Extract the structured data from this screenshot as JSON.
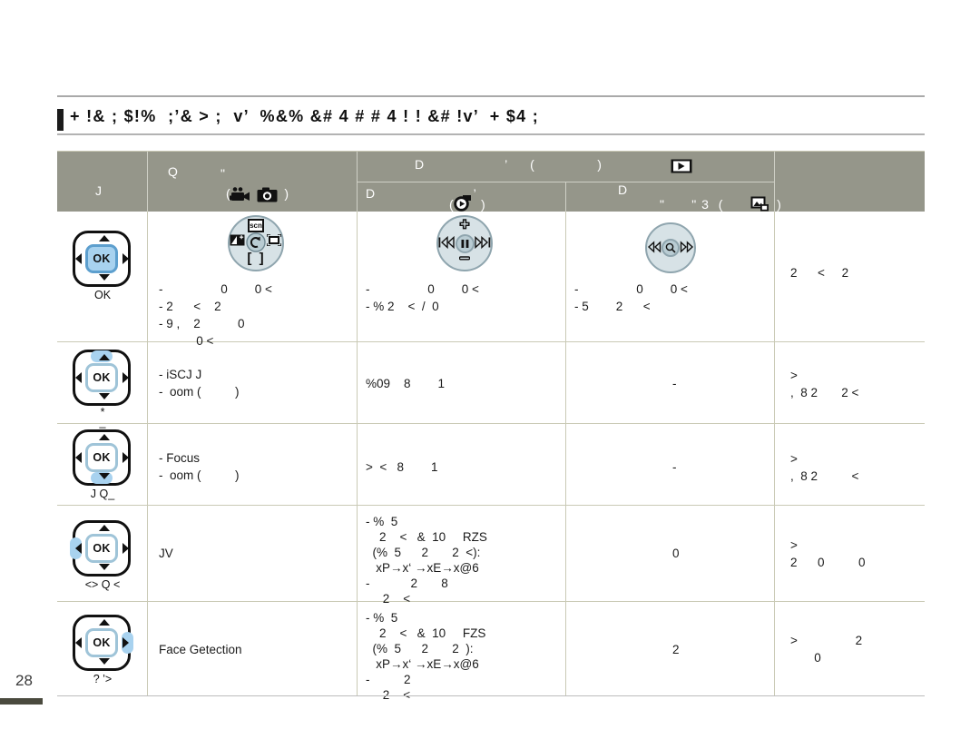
{
  "page": {
    "number": "28",
    "section_heading": "+ !& ; $!%  ;’& > ;  v’  %&% &# 4 # # 4 ! ! &# !v’  + $4 ;"
  },
  "table": {
    "headers": {
      "col_button": "J",
      "col_recording": "Q",
      "col_recording_icons": "(            )",
      "col_playback_top": "D                  ’     (              )",
      "col_playback_video": "D                      ’",
      "col_playback_video_icon": "(      )",
      "col_playback_photo": "D",
      "col_playback_photo_icon": "\"      \" 3  (            )",
      "col_last": ""
    },
    "rows": [
      {
        "name": "row-ok",
        "dpad": {
          "label": "OK",
          "highlight": "ok"
        },
        "rec_pad": "scn-pad",
        "rec_text": "-                 0        0 <\n- 2      <    2\n- 9 ,    2           0\n           0 <",
        "play_video_pad": "playpause-pad",
        "play_video_text": "-                 0        0 <\n- % 2    <  /  0",
        "play_photo_pad": "zoom-pad",
        "play_photo_text": "-                 0        0 <\n- 5        2      <",
        "last_text": "2      <     2"
      },
      {
        "name": "row-up",
        "dpad": {
          "label": "*\n_",
          "highlight": "up"
        },
        "rec_text": "- iSCJ J\n-  oom (          )",
        "play_video_text": "%09    8        1",
        "play_photo_text": "-",
        "last_text": ">\n,  8 2       2 <"
      },
      {
        "name": "row-down",
        "dpad": {
          "label": "J Q_",
          "highlight": "down"
        },
        "rec_text": "- Focus\n-  oom (          )",
        "play_video_text": ">  <   8        1",
        "play_photo_text": "-",
        "last_text": ">\n,  8 2          <"
      },
      {
        "name": "row-left",
        "dpad": {
          "label": "<> Q <",
          "highlight": "left"
        },
        "rec_text": "JV",
        "play_video_text": "- %  5\n    2    <   &  10     RZS\n  (%  5      2       2  <):\n   xP→x‘ →xE→x@6\n-            2       8\n     2    <",
        "play_photo_text": "0",
        "last_text": ">\n2      0          0"
      },
      {
        "name": "row-right",
        "dpad": {
          "label": "? ’>",
          "highlight": "right"
        },
        "rec_text": "Face Getection",
        "play_video_text": "- %  5\n    2    <   &  10     FZS\n  (%  5      2       2  ):\n   xP→x‘ →xE→x@6\n-          2\n     2    <",
        "play_photo_text": "2",
        "last_text": ">                 2\n       0"
      }
    ]
  },
  "colors": {
    "header_bg": "#95968a",
    "grid": "#c9c9b5",
    "highlight": "#a8d2ef",
    "pad_face": "#d7e2e6",
    "pad_edge": "#8fa5ae",
    "page_bar": "#4a4a3e"
  },
  "icons": {
    "video_camera": "video-camera-icon",
    "photo_camera": "photo-camera-icon",
    "play": "play-icon",
    "photo_playback": "photo-playback-icon",
    "scn": "scn-icon",
    "exposure": "exposure-icon",
    "back": "back-arrow-icon",
    "anti_shake": "anti-shake-icon",
    "focus_brackets": "focus-brackets-icon",
    "volume_up": "volume-up-icon",
    "volume_down": "volume-down-icon",
    "prev": "skip-previous-icon",
    "pause": "pause-icon",
    "next": "skip-next-icon",
    "rewind": "rewind-icon",
    "forward": "fast-forward-icon",
    "magnify": "magnify-icon"
  }
}
